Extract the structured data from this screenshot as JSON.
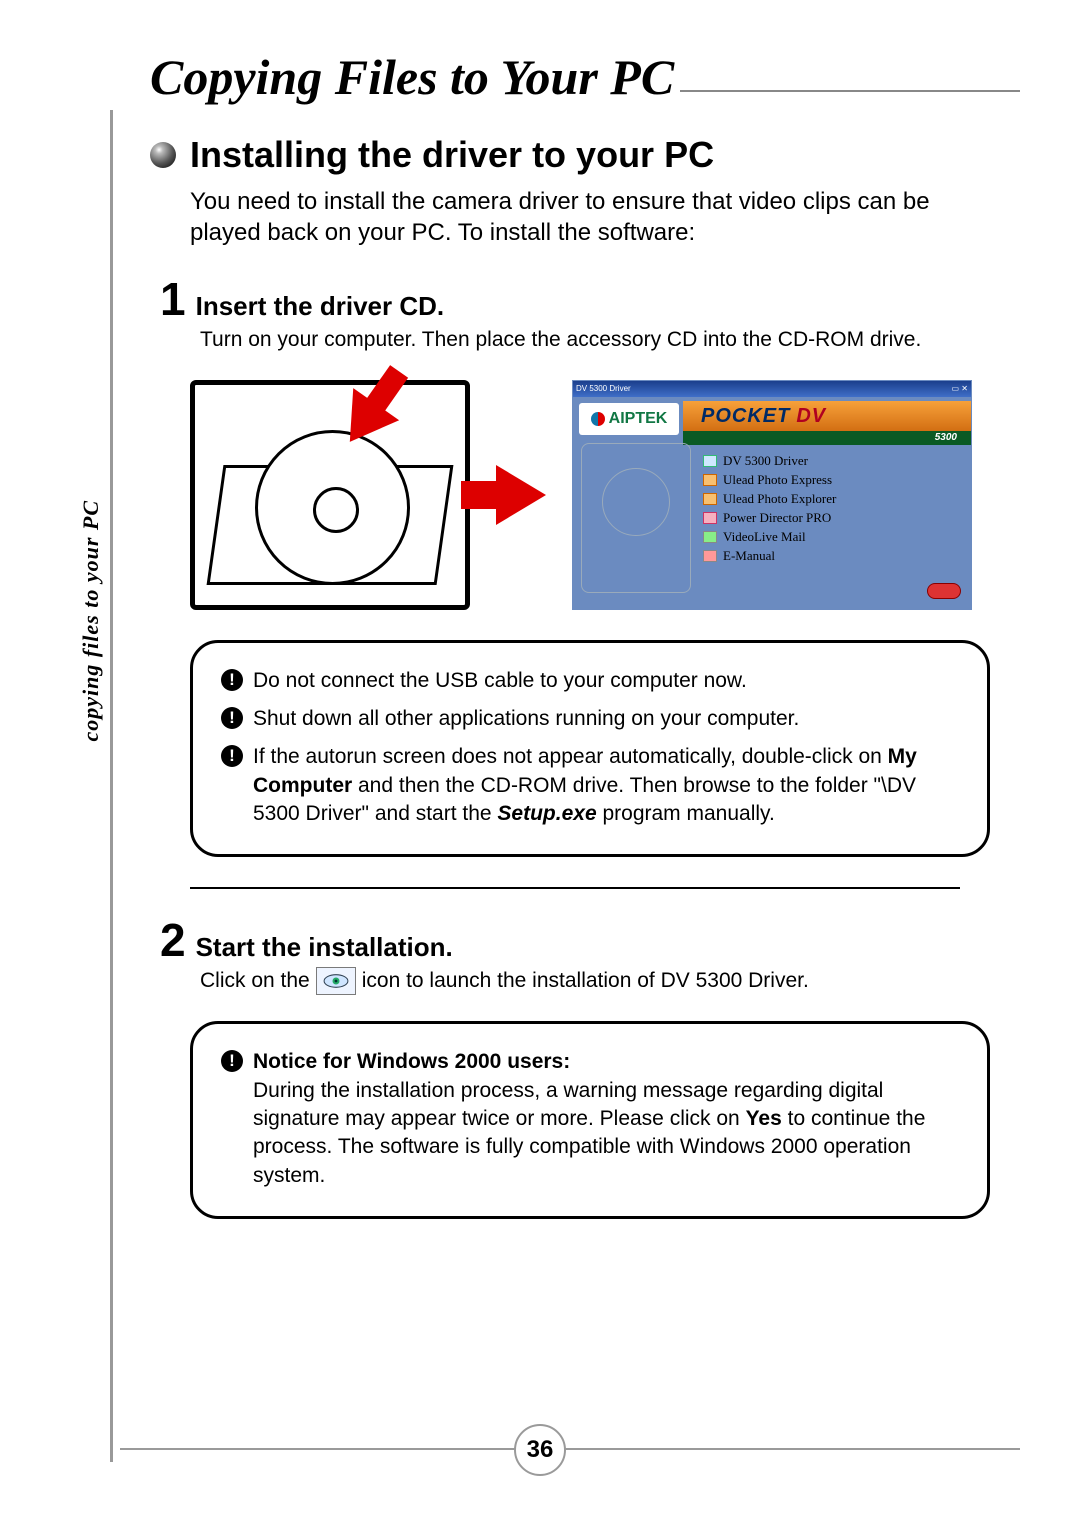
{
  "chapter_title": "Copying Files to Your PC",
  "side_caption": "copying files to your PC",
  "page_number": "36",
  "section": {
    "title": "Installing the driver to your PC",
    "intro": "You need to install the camera driver to ensure that video clips can be played back on your PC. To install the software:"
  },
  "step1": {
    "num": "1",
    "title": "Insert the driver CD.",
    "body": "Turn on your computer. Then place the accessory CD into the CD-ROM drive."
  },
  "autorun": {
    "titlebar": "DV 5300 Driver",
    "brand": "AIPTEK",
    "pocket": "POCKET",
    "dv": "DV",
    "model": "5300",
    "items": [
      "DV 5300 Driver",
      "Ulead Photo Express",
      "Ulead Photo Explorer",
      "Power Director PRO",
      "VideoLive Mail",
      "E-Manual"
    ]
  },
  "warnings1": {
    "a": "Do not connect the USB cable to your computer now.",
    "b": "Shut down all other applications running on your computer.",
    "c_pre": "If the autorun screen does not appear automatically, double-click on ",
    "c_bold1": "My Computer",
    "c_mid": " and then the CD-ROM drive. Then browse to the folder \"\\DV 5300 Driver\" and start the ",
    "c_bold2": "Setup.exe",
    "c_post": " program manually."
  },
  "step2": {
    "num": "2",
    "title": "Start the installation.",
    "pre": "Click on the",
    "post": "icon to launch the installation of DV 5300 Driver."
  },
  "warnings2": {
    "head": "Notice for Windows 2000 users:",
    "body_pre": "During the installation process, a warning message regarding digital signature may appear twice or more. Please click on ",
    "body_bold": "Yes",
    "body_post": " to continue the process. The software is fully compatible with Windows 2000 operation system."
  }
}
